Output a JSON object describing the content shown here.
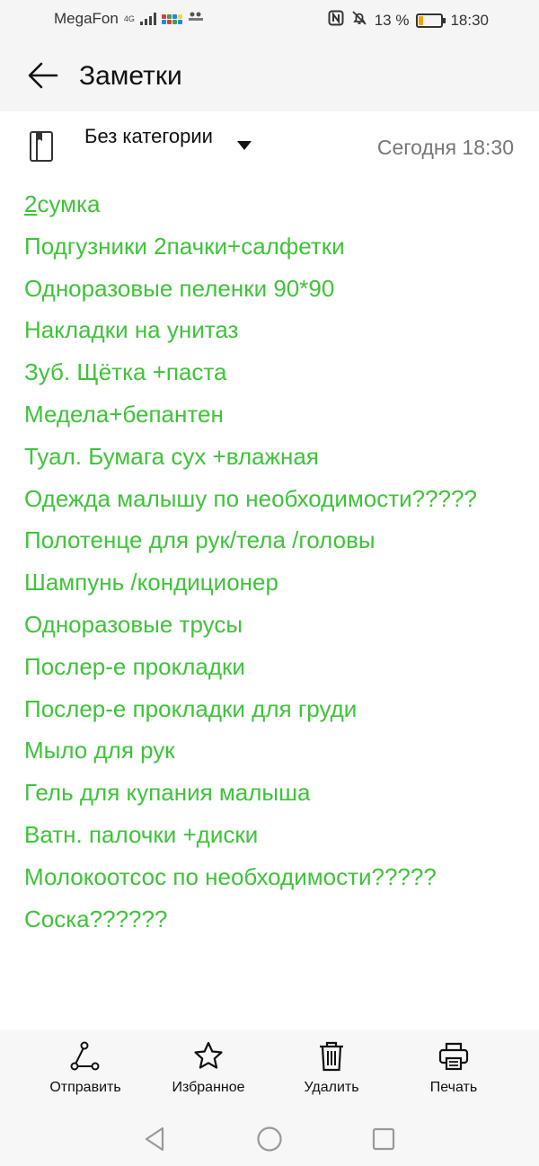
{
  "status_bar": {
    "carrier": "MegaFon",
    "network": "4G",
    "battery_text": "13 %",
    "time": "18:30"
  },
  "header": {
    "title": "Заметки"
  },
  "note_meta": {
    "category": "Без категории",
    "date": "Сегодня 18:30"
  },
  "note_lines": [
    "2сумка",
    "Подгузники 2пачки+салфетки",
    "Одноразовые пеленки 90*90",
    "Накладки на унитаз",
    "Зуб. Щётка +паста",
    "Медела+бепантен",
    "Туал. Бумага сух +влажная",
    "Одежда малышу по необходимости?????",
    "Полотенце для рук/тела /головы",
    "Шампунь /кондиционер",
    "Одноразовые трусы",
    "Послер-е прокладки",
    "Послер-е прокладки для груди",
    "Мыло для рук",
    "Гель для купания малыша",
    "Ватн. палочки +диски",
    "Молокоотсос по необходимости?????",
    "Соска??????"
  ],
  "toolbar": {
    "share_label": "Отправить",
    "favorite_label": "Избранное",
    "delete_label": "Удалить",
    "print_label": "Печать"
  },
  "colors": {
    "note_text": "#3fc33a",
    "bars_bg": "#f5f5f5"
  },
  "icons": [
    "back-arrow-icon",
    "notebook-icon",
    "dropdown-arrow-icon",
    "share-icon",
    "star-icon",
    "trash-icon",
    "printer-icon",
    "nav-back-icon",
    "nav-home-icon",
    "nav-recents-icon"
  ]
}
